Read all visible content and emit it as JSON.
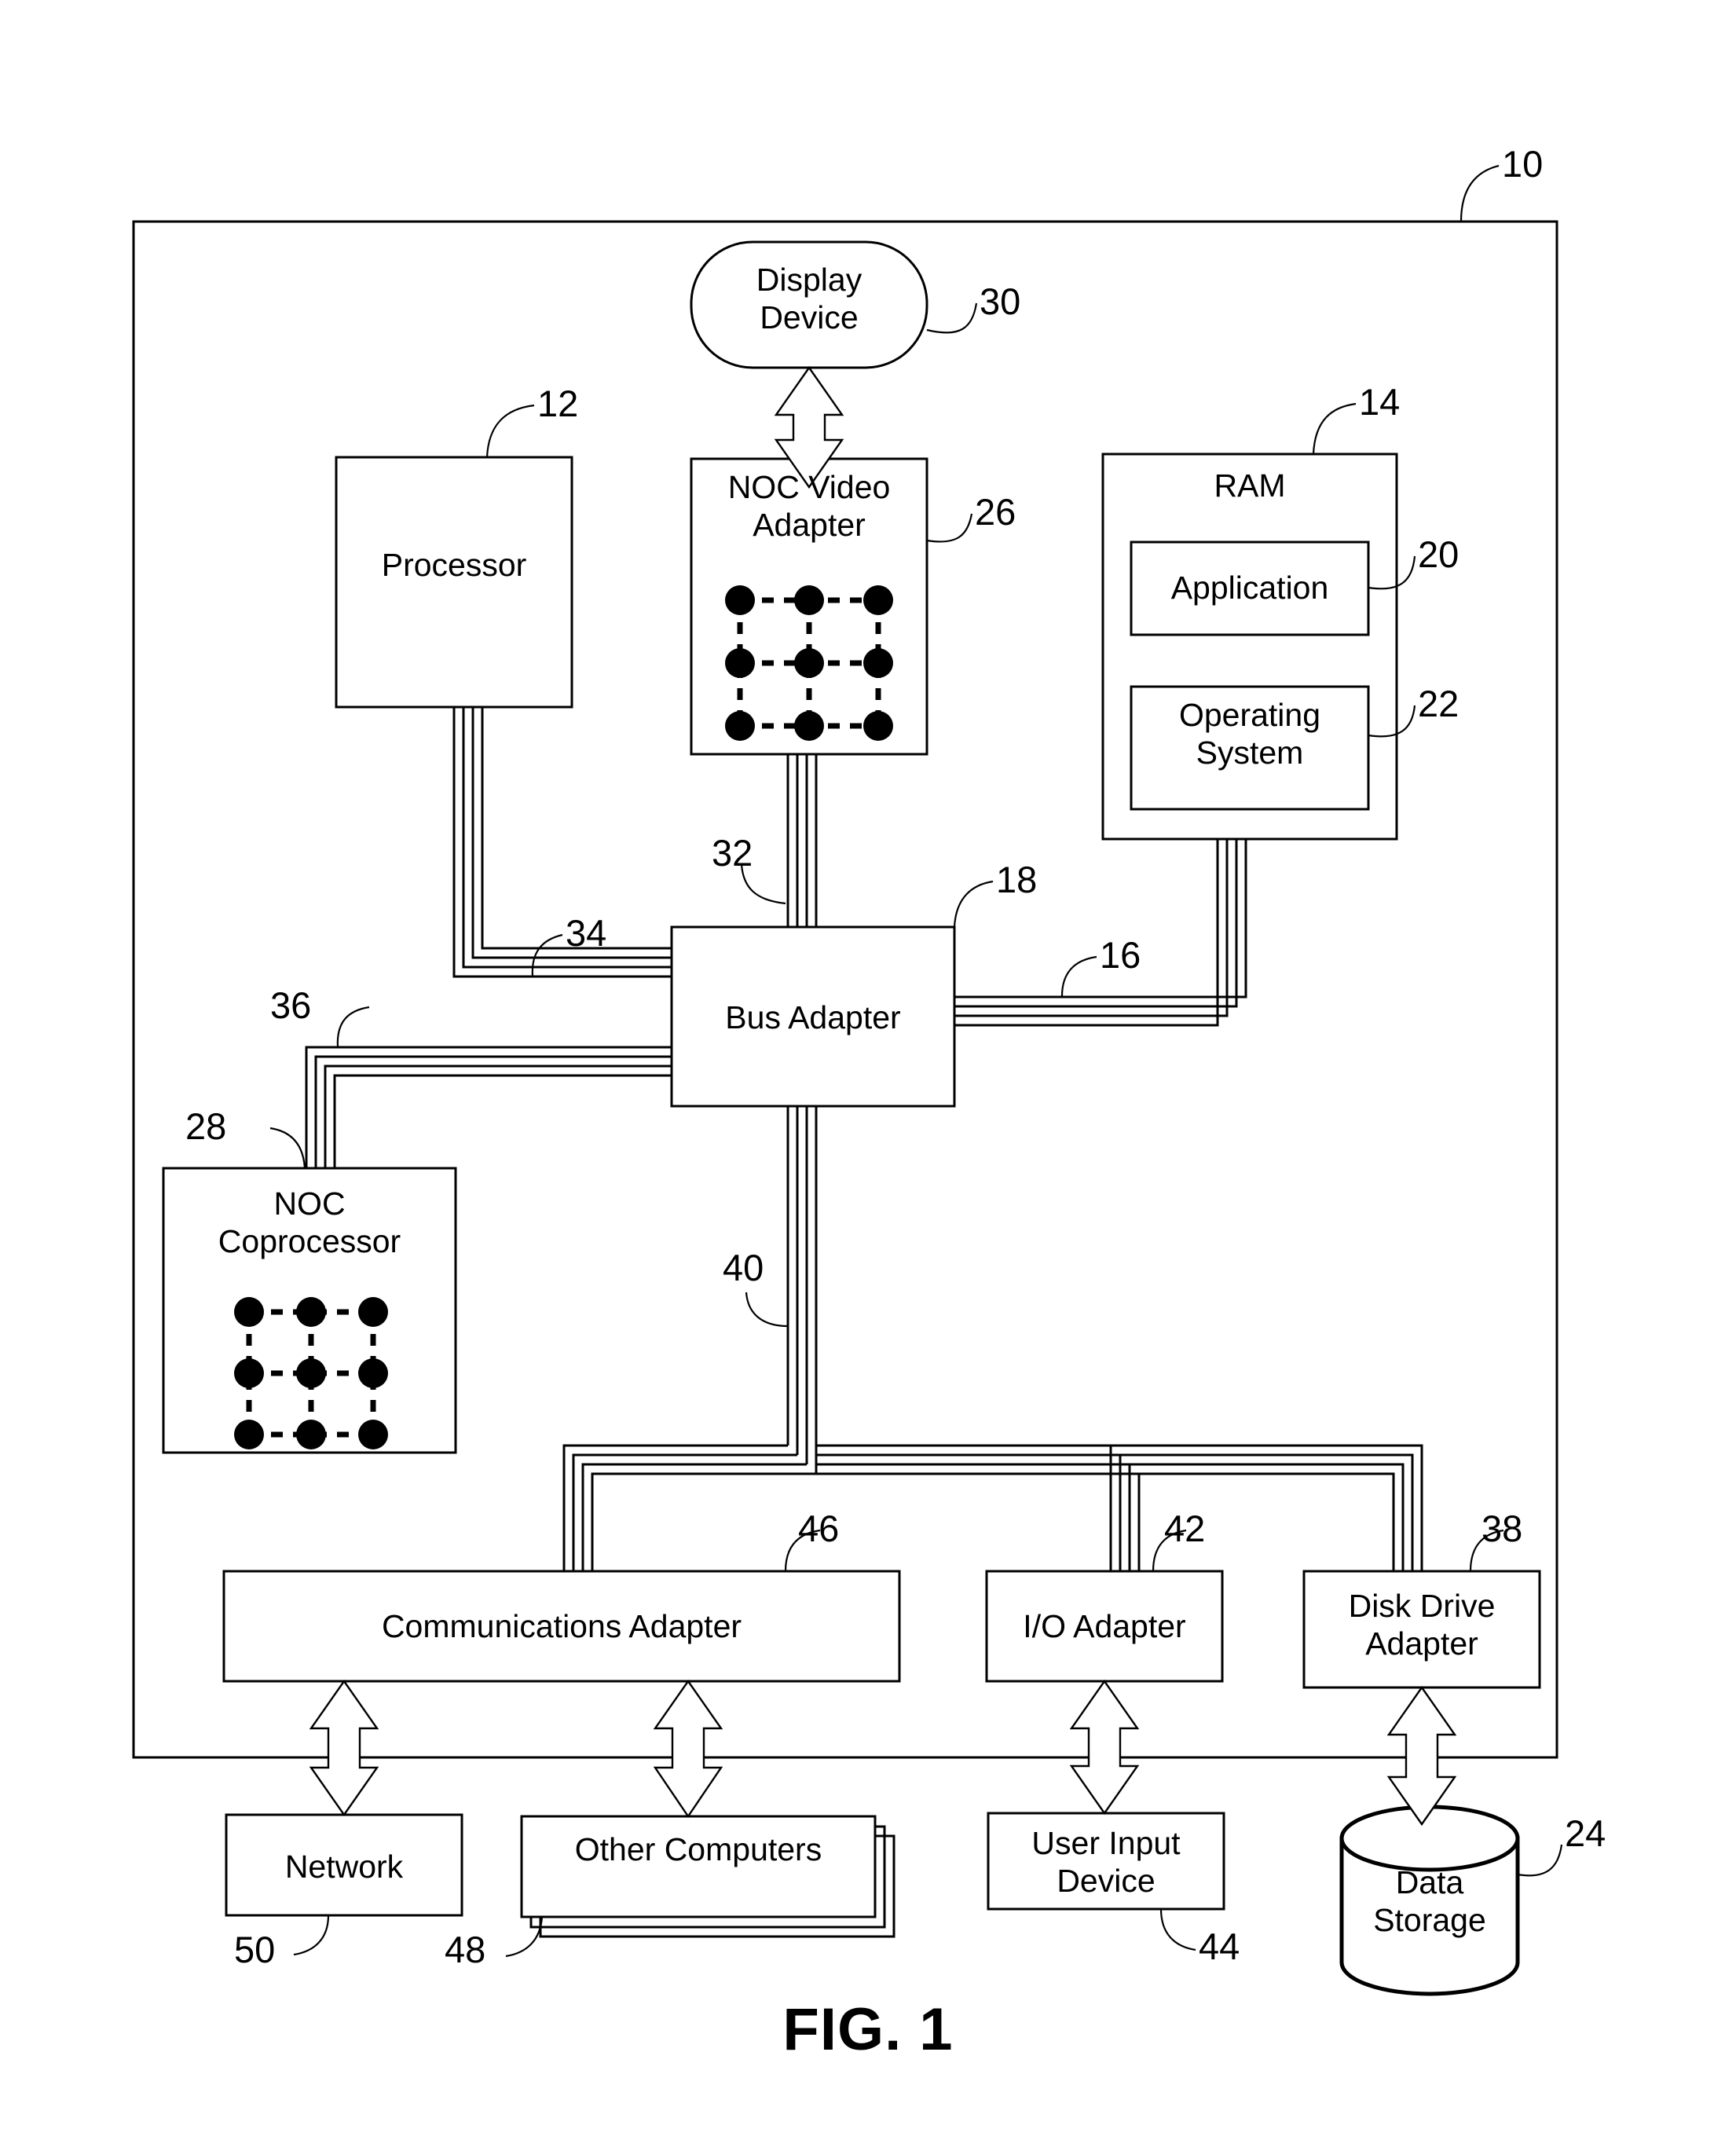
{
  "figure": {
    "caption": "FIG. 1",
    "outer_ref": "10"
  },
  "blocks": [
    {
      "id": "display-device",
      "label": "Display\nDevice",
      "ref": "30"
    },
    {
      "id": "processor",
      "label": "Processor",
      "ref": "12"
    },
    {
      "id": "noc-video-adapter",
      "label": "NOC Video\nAdapter",
      "ref": "26"
    },
    {
      "id": "ram",
      "label": "RAM",
      "ref": "14"
    },
    {
      "id": "application",
      "label": "Application",
      "ref": "20"
    },
    {
      "id": "operating-system",
      "label": "Operating\nSystem",
      "ref": "22"
    },
    {
      "id": "bus-adapter",
      "label": "Bus Adapter",
      "ref": "18"
    },
    {
      "id": "noc-coprocessor",
      "label": "NOC\nCoprocessor",
      "ref": "28"
    },
    {
      "id": "communications-adapter",
      "label": "Communications Adapter",
      "ref": "46"
    },
    {
      "id": "io-adapter",
      "label": "I/O Adapter",
      "ref": "42"
    },
    {
      "id": "disk-drive-adapter",
      "label": "Disk Drive\nAdapter",
      "ref": "38"
    },
    {
      "id": "network",
      "label": "Network",
      "ref": "50"
    },
    {
      "id": "other-computers",
      "label": "Other Computers",
      "ref": "48"
    },
    {
      "id": "user-input-device",
      "label": "User Input\nDevice",
      "ref": "44"
    },
    {
      "id": "data-storage",
      "label": "Data\nStorage",
      "ref": "24"
    }
  ],
  "bus_refs": [
    {
      "id": "video-bus",
      "ref": "32"
    },
    {
      "id": "front-side-bus-processor",
      "ref": "34"
    },
    {
      "id": "front-side-bus-memory",
      "ref": "16"
    },
    {
      "id": "coprocessor-bus",
      "ref": "36"
    },
    {
      "id": "expansion-bus",
      "ref": "40"
    }
  ],
  "colors": {
    "line": "#000000",
    "background": "#ffffff",
    "node": "#000000"
  }
}
